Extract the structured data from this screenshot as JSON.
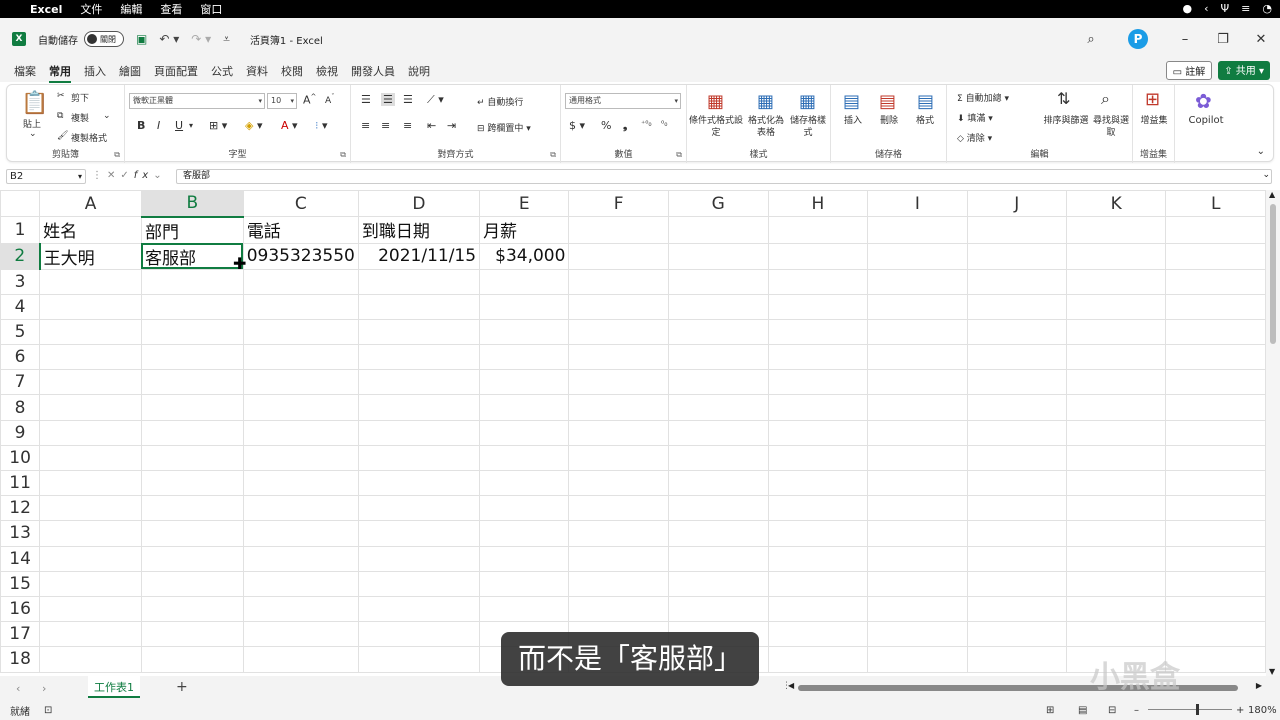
{
  "macmenu": {
    "app": "Excel",
    "items": [
      "文件",
      "編輯",
      "查看",
      "窗口"
    ]
  },
  "titlebar": {
    "autosave_label": "自動儲存",
    "autosave_state": "關閉",
    "doc_title": "活頁簿1  -  Excel",
    "profile_letter": "P"
  },
  "tabs": {
    "items": [
      "檔案",
      "常用",
      "插入",
      "繪圖",
      "頁面配置",
      "公式",
      "資料",
      "校閱",
      "檢視",
      "開發人員",
      "說明"
    ],
    "active": "常用",
    "comment": "註解",
    "share": "共用"
  },
  "ribbon": {
    "clipboard": {
      "paste": "貼上",
      "cut": "剪下",
      "copy": "複製",
      "format_painter": "複製格式",
      "label": "剪貼簿"
    },
    "font": {
      "name": "微軟正黑體",
      "size": "10",
      "label": "字型",
      "bold": "B",
      "italic": "I",
      "underline": "U"
    },
    "alignment": {
      "wrap": "自動換行",
      "merge": "跨欄置中",
      "label": "對齊方式"
    },
    "number": {
      "format": "通用格式",
      "label": "數值"
    },
    "styles": {
      "conditional": "條件式格式設定",
      "table": "格式化為表格",
      "cell": "儲存格樣式",
      "label": "樣式"
    },
    "cells": {
      "insert": "插入",
      "delete": "刪除",
      "format": "格式",
      "label": "儲存格"
    },
    "editing": {
      "autosum": "自動加總",
      "fill": "填滿",
      "clear": "清除",
      "sort": "排序與篩選",
      "find": "尋找與選取",
      "label": "編輯"
    },
    "addins": {
      "addins": "增益集",
      "label": "增益集"
    },
    "copilot": {
      "label": "Copilot"
    }
  },
  "formula_bar": {
    "name_box": "B2",
    "formula": "客服部"
  },
  "sheet": {
    "columns": [
      "A",
      "B",
      "C",
      "D",
      "E",
      "F",
      "G",
      "H",
      "I",
      "J",
      "K",
      "L"
    ],
    "rows": [
      "1",
      "2",
      "3",
      "4",
      "5",
      "6",
      "7",
      "8",
      "9",
      "10",
      "11",
      "12",
      "13",
      "14",
      "15",
      "16",
      "17",
      "18"
    ],
    "header_row": [
      "姓名",
      "部門",
      "電話",
      "到職日期",
      "月薪"
    ],
    "data_row": [
      "王大明",
      "客服部",
      "0935323550",
      "2021/11/15",
      "$34,000"
    ],
    "active_cell": "B2"
  },
  "sheet_tabs": {
    "active": "工作表1"
  },
  "status": {
    "ready": "就緒",
    "zoom": "180%"
  },
  "overlay": {
    "subtitle": "而不是「客服部」",
    "watermark": "小黑盒"
  }
}
